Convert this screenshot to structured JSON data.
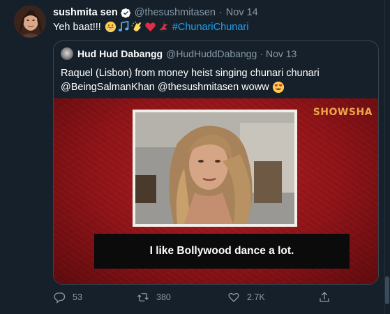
{
  "tweet": {
    "author_name": "sushmita sen",
    "handle": "@thesushmitasen",
    "time": "Nov 14",
    "text": "Yeh baat!!!",
    "emojis": [
      "grinning-face-emoji",
      "music-notes-emoji",
      "clapping-hands-emoji",
      "red-heart-emoji",
      "dancer-emoji"
    ],
    "hashtag": "#ChunariChunari"
  },
  "quote": {
    "author_name": "Hud Hud Dabangg",
    "handle": "@HudHuddDabangg",
    "time": "Nov 13",
    "text_line1": "Raquel (Lisbon) from money heist singing chunari chunari",
    "text_line2": "@BeingSalmanKhan @thesushmitasen woww",
    "emoji": "heart-eyes-emoji"
  },
  "media": {
    "brand": "SHOWSHA",
    "subtitle": "I like Bollywood dance a lot."
  },
  "actions": {
    "replies": "53",
    "retweets": "380",
    "likes": "2.7K"
  },
  "colors": {
    "background": "#15202b",
    "muted": "#8899a6",
    "link": "#1da1f2",
    "media_red": "#b31f24"
  }
}
